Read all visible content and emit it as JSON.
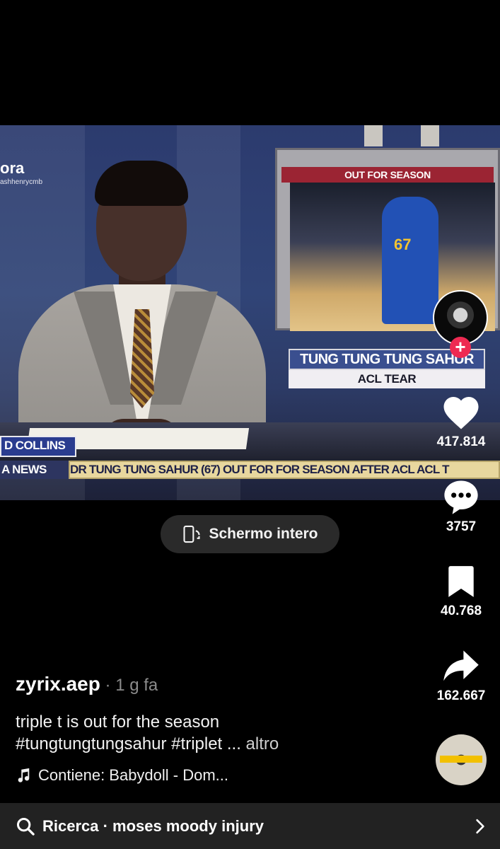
{
  "video": {
    "brand_name": "ora",
    "brand_handle": "ashhenrycmb",
    "monitor_header": "OUT FOR SEASON",
    "jersey_number": "67",
    "chyron_title": "TUNG TUNG TUNG SAHUR",
    "chyron_subtitle": "ACL TEAR",
    "name_box": "D COLLINS",
    "lower_left": "A NEWS",
    "ticker_text": "DR TUNG TUNG SAHUR (67)   OUT FOR FOR SEASON AFTER ACL ACL T"
  },
  "fullscreen_button": {
    "label": "Schermo intero",
    "icon": "fullscreen-rotate-icon"
  },
  "actions": {
    "follow_icon": "plus-icon",
    "like": {
      "icon": "heart-icon",
      "count": "417.814"
    },
    "comment": {
      "icon": "comment-bubble-icon",
      "count": "3757"
    },
    "bookmark": {
      "icon": "bookmark-icon",
      "count": "40.768"
    },
    "share": {
      "icon": "share-arrow-icon",
      "count": "162.667"
    }
  },
  "post": {
    "username": "zyrix.aep",
    "time": " · 1 g fa",
    "caption_line1": "triple t is out for the season",
    "caption_line2": "#tungtungtungsahur #triplet ...",
    "more_label": " altro",
    "sound": "Contiene: Babydoll - Dom..."
  },
  "search_bar": {
    "label": "Ricerca · moses moody injury"
  },
  "colors": {
    "background": "#000000",
    "follow_plus": "#ee2a52",
    "pill_bg": "#2a2a2a",
    "search_bar_bg": "#222222"
  }
}
